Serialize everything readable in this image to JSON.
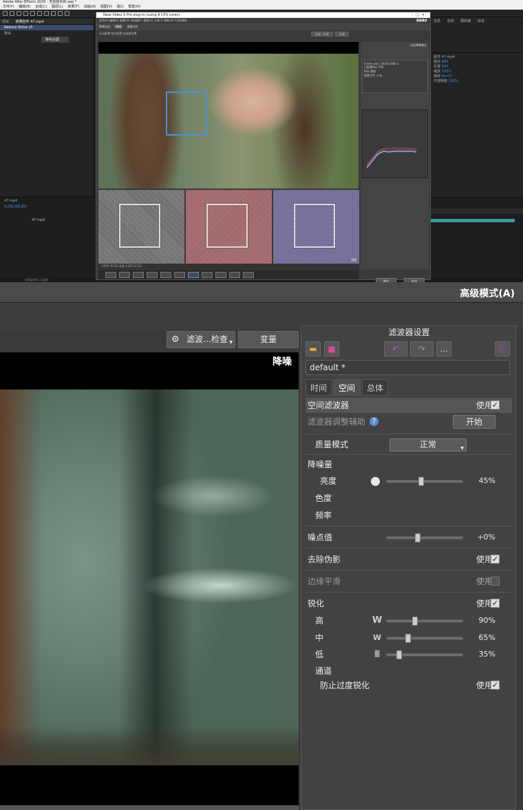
{
  "ae": {
    "title": "Adobe After Effects 2020 - 无标题项目.aep *",
    "menus": [
      "文件(F)",
      "编辑(E)",
      "合成(C)",
      "图层(L)",
      "效果(T)",
      "动画(A)",
      "视图(V)",
      "窗口",
      "帮助(H)"
    ],
    "project_panel": "项目",
    "effects_panel": "效果控件 47.mp4",
    "fx_item": "Reduce Noise v5",
    "fx_sub": "降噪",
    "fx_btn": "降噪设置",
    "right_panels": [
      "信息",
      "音频",
      "跟踪器",
      "段落"
    ],
    "right_panel2": "属性 47.mp4",
    "props": [
      "锚点",
      "位置",
      "缩放",
      "旋转",
      "不透明度"
    ],
    "right_vals": [
      "960",
      "540",
      "100%",
      "0x+0°",
      "100%"
    ],
    "timecode": "0:00:00:00",
    "comp_tab": "47.mp4",
    "layer_name": "47.mp4",
    "render_text": "帧渲染时间 23毫秒"
  },
  "nv": {
    "title": "Neat Video 5 Pro plug-in (using 8 CPU cores)",
    "menu": "应用(A) 编辑(E) 配置(O) 滤波器(F) 视图(V) 工具(T) 帮助(H)  CG资源网",
    "mode": "高级模式",
    "tabs": [
      "降噪分析",
      "降噪",
      "变量分析"
    ],
    "sub_items": "自动配置  噪点配置  滤波器设置",
    "sub_buttons": [
      "滤波…检查",
      "变量"
    ],
    "panel_title": "分析降噪噪点",
    "info_lines": [
      "Frame size: 1920x1080 p",
      "已配置Rec.709",
      "8bit 通道",
      "配置文件 .nnp"
    ],
    "thumb_label": "亮度",
    "status": "100%  YCrCb  亮度  Y:265  X:512",
    "frame_info": "Frame: 1920x1080 8-bit RGB",
    "ok": "确定",
    "cancel": "取消"
  },
  "zoom": {
    "mode_title": "高级模式(A)",
    "filter_check": "滤波…检查",
    "vary": "变量",
    "view_label": "降噪",
    "panel_title": "滤波器设置",
    "preset": "default *",
    "tabs": [
      "时间",
      "空间",
      "总体"
    ],
    "spatial_filter": "空间滤波器",
    "use": "使用",
    "tune_assist": "滤波器调整辅助",
    "start": "开始",
    "quality_mode": "质量模式",
    "quality_value": "正常",
    "noise_amount": "降噪量",
    "luma": "亮度",
    "luma_val": "45%",
    "chroma": "色度",
    "freq": "频率",
    "noise_level": "噪点值",
    "noise_level_val": "+0%",
    "artifact": "去除伪影",
    "edge": "边缘平滑",
    "sharpen": "锐化",
    "high": "高",
    "high_val": "90%",
    "mid": "中",
    "mid_val": "65%",
    "low": "低",
    "low_val": "35%",
    "channel": "通道",
    "prevent": "防止过度锐化",
    "slider_levels": {
      "luma": 0.45,
      "noise": 0.41,
      "high": 0.37,
      "mid": 0.28,
      "low": 0.16
    }
  }
}
